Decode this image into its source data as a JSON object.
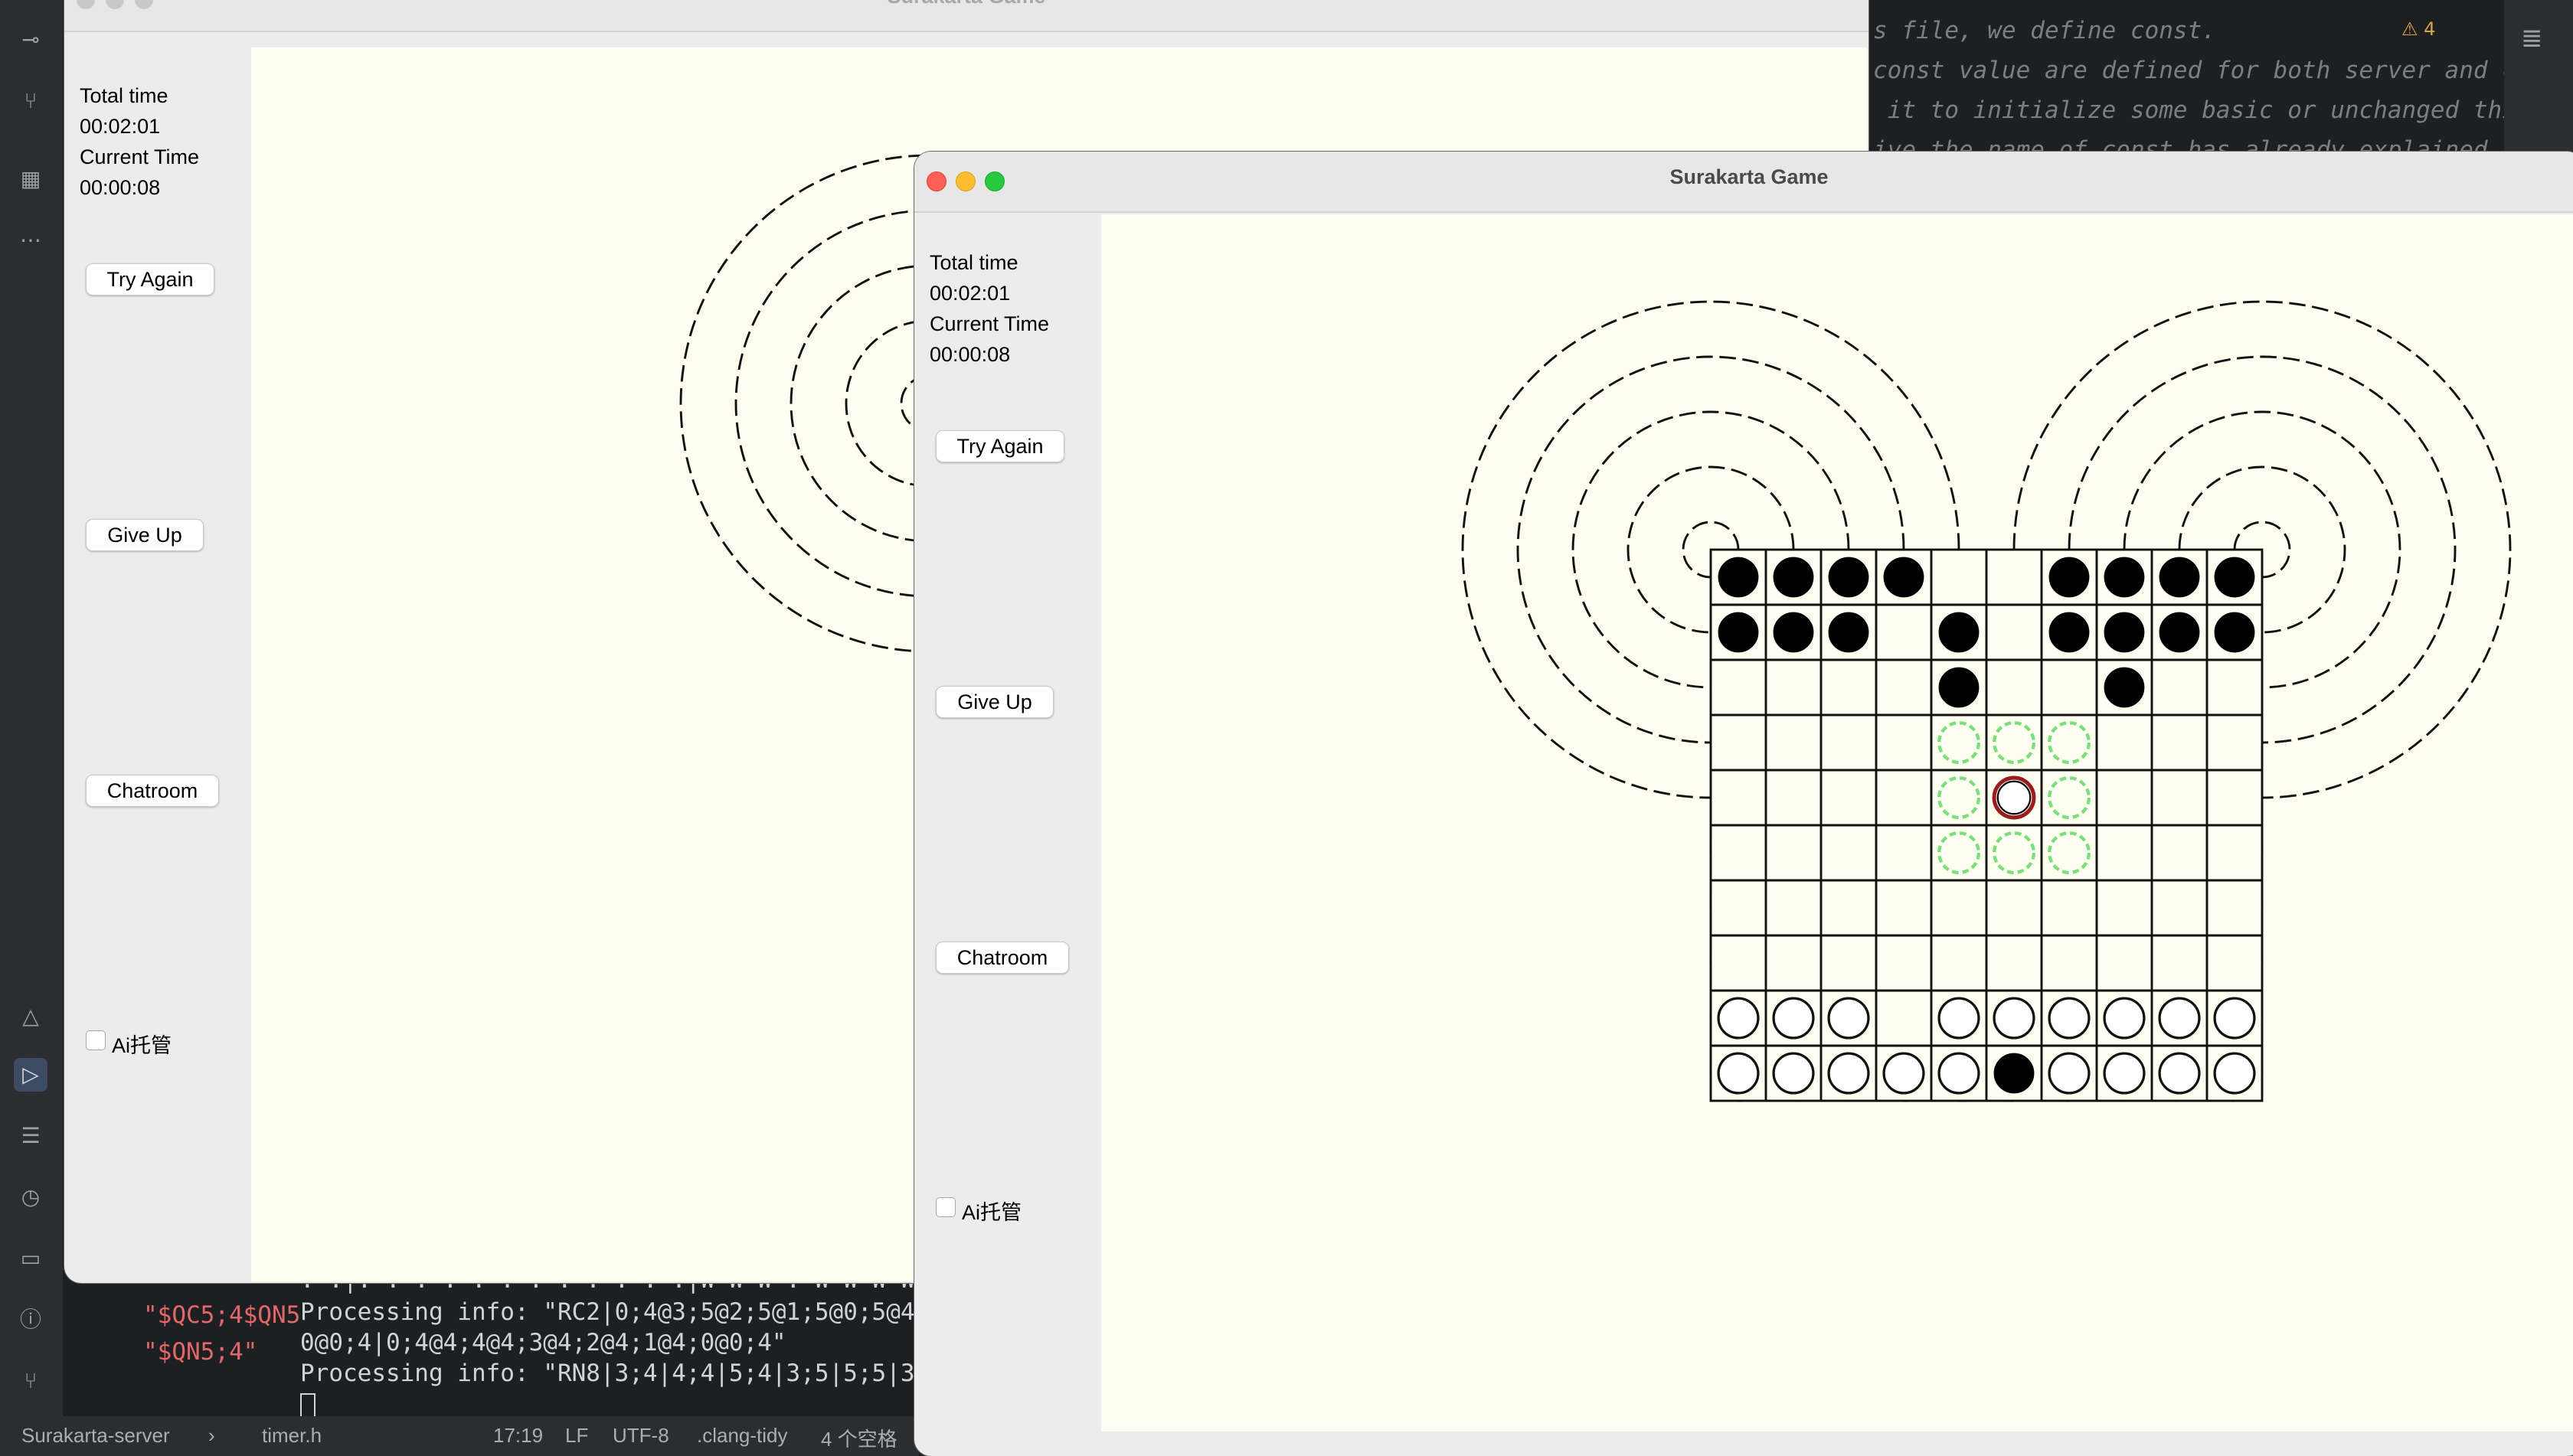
{
  "ide": {
    "code_lines": [
      "s file, we define const.",
      "const value are defined for both server and cli",
      " it to initialize some basic or unchanged thing",
      "ive the name of const has already explained"
    ],
    "warning_count": "4",
    "terminal": {
      "left_lines": [
        "\"$QC5;4$QN5",
        "\"$QN5;4\""
      ],
      "lines": [
        ". .|. . . . . . . . . . . .|W W W . W W W W W",
        "Processing info: \"RC2|0;4@3;5@2;5@1;5@0;5@4;5",
        "0@0;4|0;4@4;4@4;3@4;2@4;1@4;0@0;4\"",
        "Processing info: \"RN8|3;4|4;4|5;4|3;5|5;5|3;4"
      ]
    },
    "status_bar": {
      "project": "Surakarta-server",
      "file": "timer.h",
      "position": "17:19",
      "line_sep": "LF",
      "encoding": "UTF-8",
      "linter": ".clang-tidy",
      "indent": "4 个空格"
    }
  },
  "back_window": {
    "title": "Surakarta Game",
    "total_time_label": "Total time",
    "total_time": "00:02:01",
    "current_time_label": "Current Time",
    "current_time": "00:00:08",
    "try_again": "Try Again",
    "give_up": "Give Up",
    "chatroom": "Chatroom",
    "ai_label": "Ai托管",
    "ai_checked": false
  },
  "front_window": {
    "title": "Surakarta Game",
    "total_time_label": "Total time",
    "total_time": "00:02:01",
    "current_time_label": "Current Time",
    "current_time": "00:00:08",
    "try_again": "Try Again",
    "give_up": "Give Up",
    "chatroom": "Chatroom",
    "ai_label": "Ai托管",
    "ai_checked": false
  },
  "board": {
    "size": 10,
    "black_pieces": [
      [
        0,
        0
      ],
      [
        0,
        1
      ],
      [
        0,
        2
      ],
      [
        0,
        3
      ],
      [
        0,
        6
      ],
      [
        0,
        7
      ],
      [
        0,
        8
      ],
      [
        0,
        9
      ],
      [
        1,
        0
      ],
      [
        1,
        1
      ],
      [
        1,
        2
      ],
      [
        1,
        4
      ],
      [
        1,
        6
      ],
      [
        1,
        7
      ],
      [
        1,
        8
      ],
      [
        1,
        9
      ],
      [
        2,
        4
      ],
      [
        2,
        7
      ],
      [
        9,
        5
      ]
    ],
    "white_pieces": [
      [
        8,
        0
      ],
      [
        8,
        1
      ],
      [
        8,
        2
      ],
      [
        8,
        4
      ],
      [
        8,
        5
      ],
      [
        8,
        6
      ],
      [
        8,
        7
      ],
      [
        8,
        8
      ],
      [
        8,
        9
      ],
      [
        9,
        0
      ],
      [
        9,
        1
      ],
      [
        9,
        2
      ],
      [
        9,
        3
      ],
      [
        9,
        4
      ],
      [
        9,
        6
      ],
      [
        9,
        7
      ],
      [
        9,
        8
      ],
      [
        9,
        9
      ]
    ],
    "last_moved_black": [
      0,
      4
    ],
    "selected_white": [
      4,
      5
    ],
    "move_hints": [
      [
        3,
        4
      ],
      [
        3,
        5
      ],
      [
        3,
        6
      ],
      [
        4,
        4
      ],
      [
        4,
        6
      ],
      [
        5,
        4
      ],
      [
        5,
        5
      ],
      [
        5,
        6
      ]
    ],
    "colors": {
      "board_bg": "#fefef0",
      "black": "#000000",
      "white": "#ffffff",
      "selected_ring": "#9b1c1c",
      "last_move_ring": "#2f7a2f",
      "hint": "#7be07b"
    }
  },
  "back_board_visible": {
    "black_rows": [
      0,
      1
    ],
    "white_rows": [
      8,
      9
    ]
  }
}
